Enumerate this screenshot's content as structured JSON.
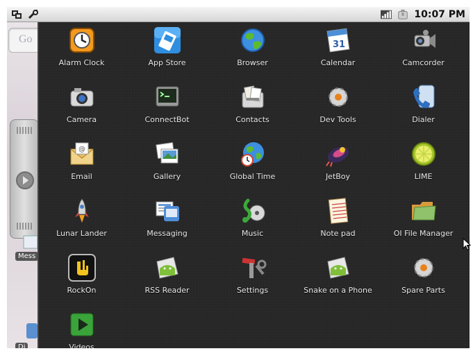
{
  "status_bar": {
    "time": "10:07 PM",
    "icons_left": [
      "usb-debug-icon",
      "wrench-icon"
    ],
    "icons_right": [
      "signal-icon",
      "battery-charging-icon"
    ]
  },
  "home": {
    "search_hint": "Go",
    "label_1": "Mess",
    "label_2": "Di"
  },
  "apps": [
    {
      "label": "Alarm Clock",
      "icon": "alarm-clock-icon"
    },
    {
      "label": "App Store",
      "icon": "app-store-icon"
    },
    {
      "label": "Browser",
      "icon": "browser-globe-icon"
    },
    {
      "label": "Calendar",
      "icon": "calendar-icon",
      "day": "31"
    },
    {
      "label": "Camcorder",
      "icon": "camcorder-icon"
    },
    {
      "label": "Camera",
      "icon": "camera-icon"
    },
    {
      "label": "ConnectBot",
      "icon": "terminal-icon"
    },
    {
      "label": "Contacts",
      "icon": "contacts-icon"
    },
    {
      "label": "Dev Tools",
      "icon": "gear-icon"
    },
    {
      "label": "Dialer",
      "icon": "phone-icon"
    },
    {
      "label": "Email",
      "icon": "email-icon"
    },
    {
      "label": "Gallery",
      "icon": "gallery-icon"
    },
    {
      "label": "Global Time",
      "icon": "globe-clock-icon"
    },
    {
      "label": "JetBoy",
      "icon": "jetboy-icon"
    },
    {
      "label": "LIME",
      "icon": "lime-icon"
    },
    {
      "label": "Lunar Lander",
      "icon": "rocket-icon"
    },
    {
      "label": "Messaging",
      "icon": "messaging-icon"
    },
    {
      "label": "Music",
      "icon": "music-icon"
    },
    {
      "label": "Note pad",
      "icon": "notepad-icon"
    },
    {
      "label": "OI File Manager",
      "icon": "folder-icon"
    },
    {
      "label": "RockOn",
      "icon": "rockon-icon"
    },
    {
      "label": "RSS Reader",
      "icon": "rss-android-icon"
    },
    {
      "label": "Settings",
      "icon": "settings-tools-icon"
    },
    {
      "label": "Snake on a Phone",
      "icon": "snake-android-icon"
    },
    {
      "label": "Spare Parts",
      "icon": "spare-parts-gear-icon"
    },
    {
      "label": "Videos",
      "icon": "play-video-icon"
    }
  ]
}
